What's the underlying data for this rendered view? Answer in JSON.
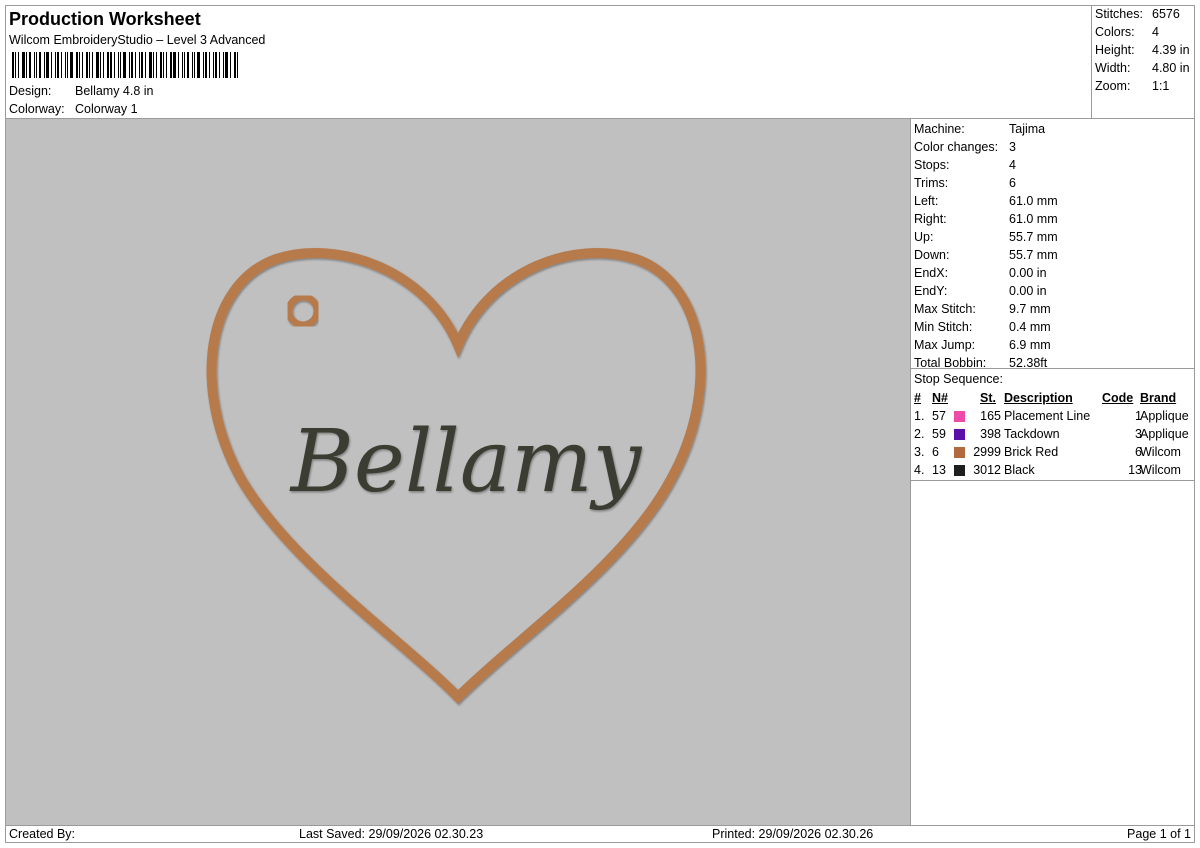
{
  "header": {
    "title": "Production Worksheet",
    "software": "Wilcom EmbroideryStudio – Level 3 Advanced",
    "design_label": "Design:",
    "design_value": "Bellamy 4.8 in",
    "colorway_label": "Colorway:",
    "colorway_value": "Colorway 1"
  },
  "summary": [
    {
      "label": "Stitches:",
      "value": "6576"
    },
    {
      "label": "Colors:",
      "value": "4"
    },
    {
      "label": "Height:",
      "value": "4.39 in"
    },
    {
      "label": "Width:",
      "value": "4.80 in"
    },
    {
      "label": "Zoom:",
      "value": "1:1"
    }
  ],
  "design": {
    "text": "Bellamy",
    "outline_color": "#b77a4c",
    "text_color": "#3b3d33",
    "background_color": "#c0c0c0"
  },
  "info": [
    {
      "label": "Machine:",
      "value": "Tajima"
    },
    {
      "label": "Color changes:",
      "value": "3"
    },
    {
      "label": "Stops:",
      "value": "4"
    },
    {
      "label": "Trims:",
      "value": "6"
    },
    {
      "label": "Left:",
      "value": "61.0 mm"
    },
    {
      "label": "Right:",
      "value": "61.0 mm"
    },
    {
      "label": "Up:",
      "value": "55.7 mm"
    },
    {
      "label": "Down:",
      "value": "55.7 mm"
    },
    {
      "label": "EndX:",
      "value": "0.00 in"
    },
    {
      "label": "EndY:",
      "value": "0.00 in"
    },
    {
      "label": "Max Stitch:",
      "value": "9.7 mm"
    },
    {
      "label": "Min Stitch:",
      "value": "0.4 mm"
    },
    {
      "label": "Max Jump:",
      "value": "6.9 mm"
    },
    {
      "label": "Total Bobbin:",
      "value": "52.38ft"
    }
  ],
  "stops": {
    "title": "Stop Sequence:",
    "headers": {
      "num": "#",
      "n": "N#",
      "st": "St.",
      "desc": "Description",
      "code": "Code",
      "brand": "Brand"
    },
    "rows": [
      {
        "num": "1.",
        "n": "57",
        "color": "#f04aa8",
        "st": "165",
        "desc": "Placement Line",
        "code": "1",
        "brand": "Applique"
      },
      {
        "num": "2.",
        "n": "59",
        "color": "#5b0fa8",
        "st": "398",
        "desc": "Tackdown",
        "code": "3",
        "brand": "Applique"
      },
      {
        "num": "3.",
        "n": "6",
        "color": "#b06a3e",
        "st": "2999",
        "desc": "Brick Red",
        "code": "6",
        "brand": "Wilcom"
      },
      {
        "num": "4.",
        "n": "13",
        "color": "#1e1e1e",
        "st": "3012",
        "desc": "Black",
        "code": "13",
        "brand": "Wilcom"
      }
    ]
  },
  "footer": {
    "created": "Created By:",
    "saved": "Last Saved: 29/09/2026 02.30.23",
    "printed": "Printed: 29/09/2026 02.30.26",
    "page": "Page 1 of 1"
  }
}
